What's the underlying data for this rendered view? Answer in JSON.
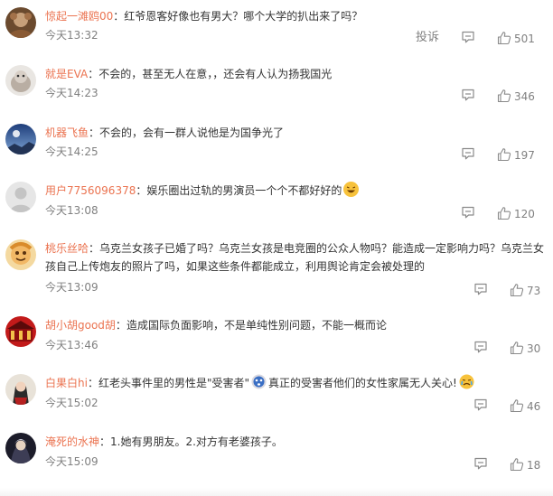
{
  "comments": [
    {
      "name": "惊起一滩鸥00",
      "text": "红爷恩客好像也有男大？哪个大学的扒出来了吗？",
      "time": "今天13:32",
      "likes": "501",
      "report": "投诉"
    },
    {
      "name": "就是EVA",
      "text": "不会的，甚至无人在意，，还会有人认为扬我国光",
      "time": "今天14:23",
      "likes": "346"
    },
    {
      "name": "机器飞鱼",
      "text": "不会的，会有一群人说他是为国争光了",
      "time": "今天14:25",
      "likes": "197"
    },
    {
      "name": "用户7756096378",
      "text": "娱乐圈出过轨的男演员一个个不都好好的",
      "time": "今天13:08",
      "likes": "120"
    },
    {
      "name": "桃乐丝哈",
      "text": "乌克兰女孩子已婚了吗？乌克兰女孩是电竞圈的公众人物吗？能造成一定影响力吗？乌克兰女孩自己上传炮友的照片了吗，如果这些条件都能成立，利用舆论肯定会被处理的",
      "time": "今天13:09",
      "likes": "73"
    },
    {
      "name": "胡小胡good胡",
      "text": "造成国际负面影响，不是单纯性别问题，不能一概而论",
      "time": "今天13:46",
      "likes": "30"
    },
    {
      "name": "白果白hi",
      "text_a": "红老头事件里的男性是\"受害者\"",
      "text_b": "真正的受害者他们的女性家属无人关心!",
      "time": "今天15:02",
      "likes": "46"
    },
    {
      "name": "淹死的水神",
      "text": "1.她有男朋友。2.对方有老婆孩子。",
      "time": "今天15:09",
      "likes": "18"
    }
  ],
  "colors": {
    "name": "#eb7350",
    "text": "#333333",
    "meta": "#808080"
  }
}
